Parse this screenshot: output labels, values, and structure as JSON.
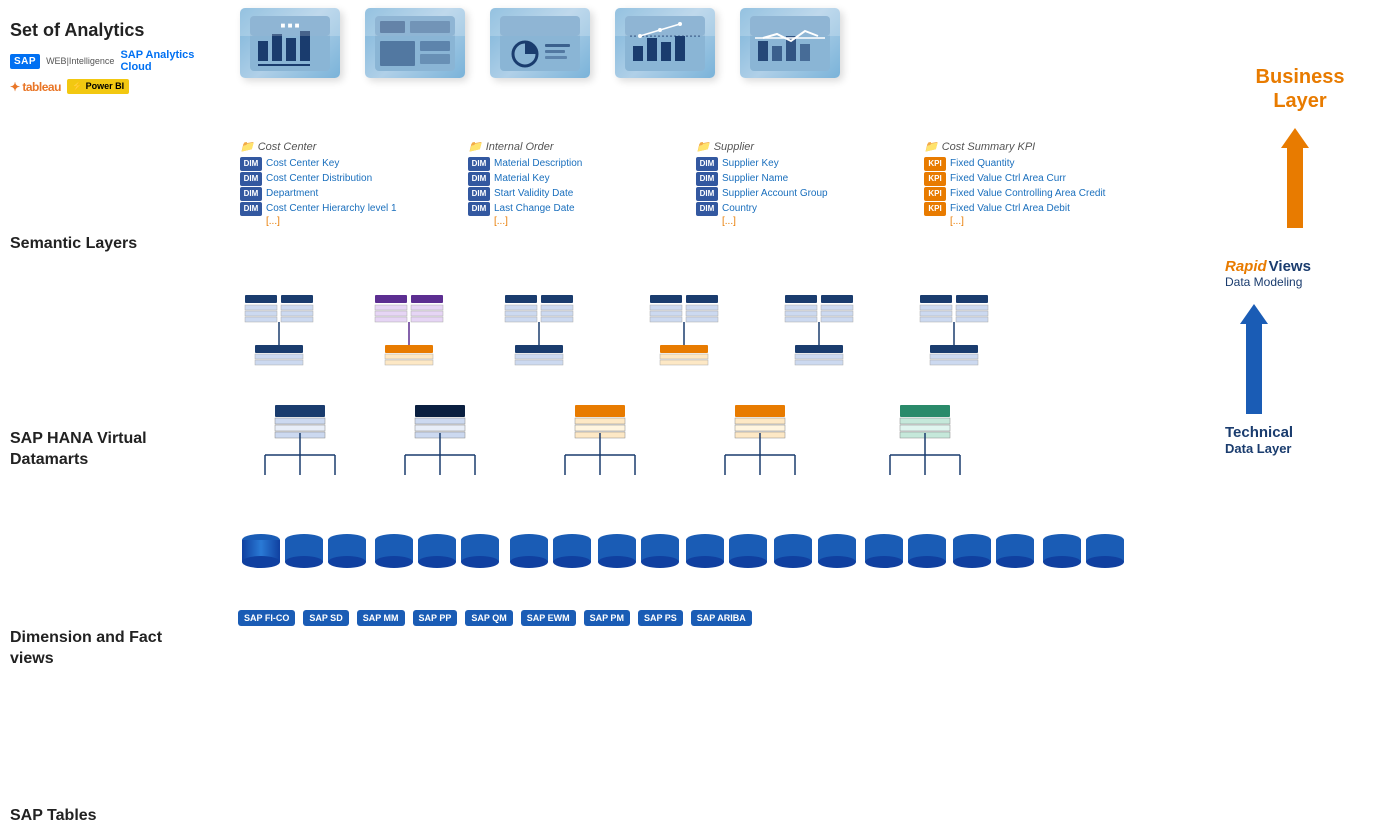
{
  "labels": {
    "set_analytics": "Set of Analytics",
    "semantic_layers": "Semantic Layers",
    "hana_title": "SAP HANA Virtual",
    "hana_sub": "Datamarts",
    "dim_fact": "Dimension and Fact views",
    "sap_tables": "SAP Tables",
    "business_layer": "Business Layer",
    "rapidviews": "RapidViews",
    "data_modeling": "Data Modeling",
    "technical": "Technical",
    "data_layer": "Data Layer"
  },
  "logos": {
    "sap": "SAP",
    "web_intel": "WEB|Intelligence",
    "analytics_cloud": "SAP Analytics Cloud",
    "tableau": "+ tableau",
    "power_bi": "Power BI"
  },
  "semantic_cards": [
    {
      "folder": "Cost Center",
      "fields": [
        {
          "badge": "DIM",
          "label": "Cost Center Key"
        },
        {
          "badge": "DIM",
          "label": "Cost Center Distribution"
        },
        {
          "badge": "DIM",
          "label": "Department"
        },
        {
          "badge": "DIM",
          "label": "Cost Center Hierarchy level 1"
        }
      ],
      "more": "[...]"
    },
    {
      "folder": "Internal Order",
      "fields": [
        {
          "badge": "DIM",
          "label": "Material Description"
        },
        {
          "badge": "DIM",
          "label": "Material Key"
        },
        {
          "badge": "DIM",
          "label": "Start Validity Date"
        },
        {
          "badge": "DIM",
          "label": "Last Change Date"
        }
      ],
      "more": "[...]"
    },
    {
      "folder": "Supplier",
      "fields": [
        {
          "badge": "DIM",
          "label": "Supplier Key"
        },
        {
          "badge": "DIM",
          "label": "Supplier Name"
        },
        {
          "badge": "DIM",
          "label": "Supplier Account Group"
        },
        {
          "badge": "DIM",
          "label": "Country"
        }
      ],
      "more": "[...]"
    },
    {
      "folder": "Cost Summary KPI",
      "fields": [
        {
          "badge": "KPI",
          "label": "Fixed Quantity"
        },
        {
          "badge": "KPI",
          "label": "Fixed Value Ctrl Area Curr"
        },
        {
          "badge": "KPI",
          "label": "Fixed Value Controlling Area Credit"
        },
        {
          "badge": "KPI",
          "label": "Fixed Value Ctrl Area Debit"
        }
      ],
      "more": "[...]"
    }
  ],
  "sap_modules": [
    "SAP FI-CO",
    "SAP SD",
    "SAP MM",
    "SAP PP",
    "SAP QM",
    "SAP EWM",
    "SAP PM",
    "SAP PS",
    "SAP ARIBA"
  ],
  "view_headers": [
    "blue",
    "darknavy",
    "orange",
    "orange",
    "teal"
  ]
}
